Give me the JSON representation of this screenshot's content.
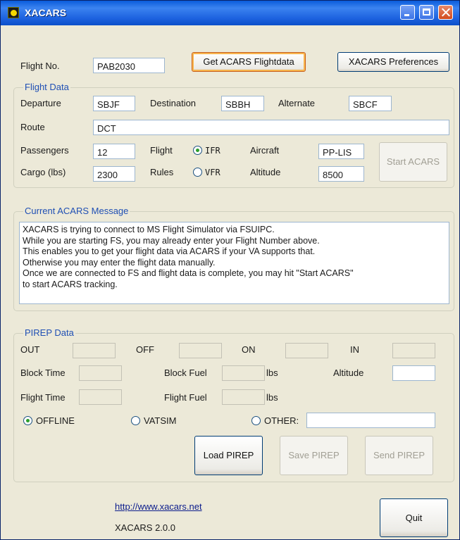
{
  "window": {
    "title": "XACARS"
  },
  "flight": {
    "number_label": "Flight No.",
    "number_value": "PAB2030",
    "get_button": "Get ACARS Flightdata",
    "prefs_button": "XACARS Preferences"
  },
  "flight_data": {
    "title": "Flight Data",
    "departure_label": "Departure",
    "departure_value": "SBJF",
    "destination_label": "Destination",
    "destination_value": "SBBH",
    "alternate_label": "Alternate",
    "alternate_value": "SBCF",
    "route_label": "Route",
    "route_value": "DCT",
    "passengers_label": "Passengers",
    "passengers_value": "12",
    "cargo_label": "Cargo (lbs)",
    "cargo_value": "2300",
    "flight_label": "Flight",
    "rules_label": "Rules",
    "ifr_label": "IFR",
    "vfr_label": "VFR",
    "flight_rules_selected": "IFR",
    "aircraft_label": "Aircraft",
    "aircraft_value": "PP-LIS",
    "altitude_label": "Altitude",
    "altitude_value": "8500",
    "start_button": "Start ACARS"
  },
  "acars": {
    "title": "Current ACARS Message",
    "message": "XACARS is trying to connect to MS Flight Simulator via FSUIPC.\nWhile you are starting FS, you may already enter your Flight Number above.\nThis enables you to get your flight data via ACARS if your VA supports that.\nOtherwise you may enter the flight data manually.\nOnce we are connected to FS and flight data is complete, you may hit \"Start ACARS\"\nto start ACARS tracking."
  },
  "pirep": {
    "title": "PIREP Data",
    "out_label": "OUT",
    "off_label": "OFF",
    "on_label": "ON",
    "in_label": "IN",
    "block_time_label": "Block Time",
    "block_fuel_label": "Block Fuel",
    "flight_time_label": "Flight Time",
    "flight_fuel_label": "Flight Fuel",
    "lbs_unit": "lbs",
    "altitude_label": "Altitude",
    "offline_label": "OFFLINE",
    "vatsim_label": "VATSIM",
    "other_label": "OTHER:",
    "network_selected": "OFFLINE",
    "load_button": "Load PIREP",
    "save_button": "Save PIREP",
    "send_button": "Send PIREP"
  },
  "footer": {
    "link": "http://www.xacars.net",
    "version": "XACARS 2.0.0",
    "quit_button": "Quit"
  }
}
